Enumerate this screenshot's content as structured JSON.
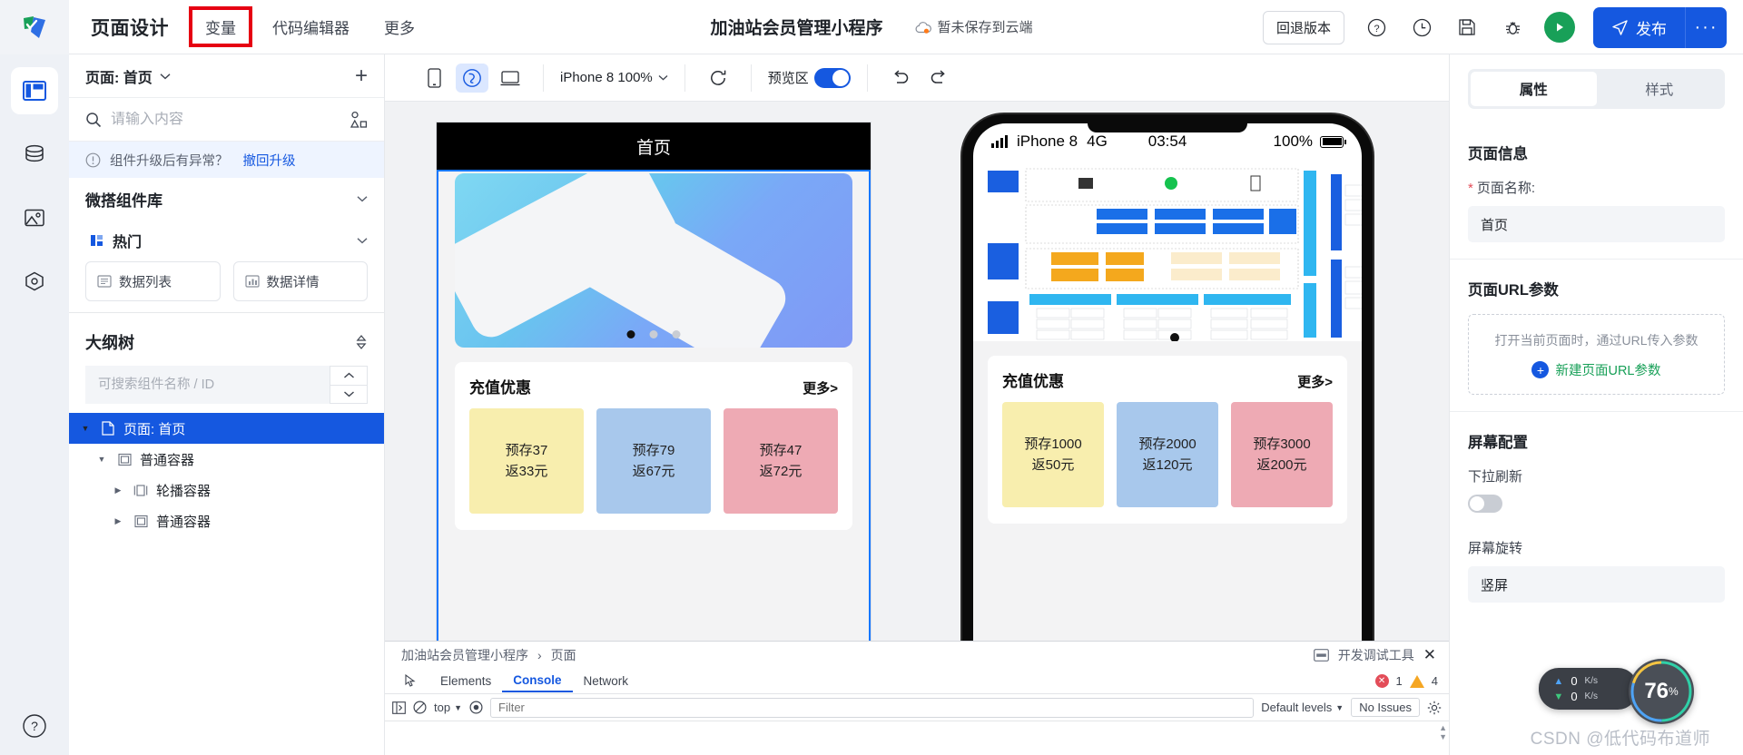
{
  "header": {
    "app_title": "页面设计",
    "nav_items": [
      {
        "label": "变量",
        "highlighted": true
      },
      {
        "label": "代码编辑器",
        "highlighted": false
      },
      {
        "label": "更多",
        "highlighted": false
      }
    ],
    "project_name": "加油站会员管理小程序",
    "cloud_status": "暂未保存到云端",
    "rollback_label": "回退版本",
    "publish_label": "发布",
    "publish_more_label": "···",
    "accent_color": "#1558e0",
    "highlight_color": "#e60012"
  },
  "rail": {
    "items": [
      {
        "name": "layout-icon",
        "active": true
      },
      {
        "name": "database-icon",
        "active": false
      },
      {
        "name": "image-icon",
        "active": false
      },
      {
        "name": "plugin-icon",
        "active": false
      }
    ],
    "help_label": "?"
  },
  "left_panel": {
    "page_selector": "页面: 首页",
    "add_label": "+",
    "search_placeholder": "请输入内容",
    "notice_text": "组件升级后有异常？",
    "notice_link": "撤回升级",
    "library_title": "微搭组件库",
    "hot_title": "热门",
    "components": [
      {
        "label": "数据列表",
        "icon": "list-icon"
      },
      {
        "label": "数据详情",
        "icon": "chart-icon"
      }
    ],
    "outline_title": "大纲树",
    "tree_search_placeholder": "可搜索组件名称 / ID",
    "tree": [
      {
        "label": "页面: 首页",
        "depth": 0,
        "selected": true,
        "expanded": true,
        "icon": "page-icon"
      },
      {
        "label": "普通容器",
        "depth": 1,
        "selected": false,
        "expanded": true,
        "icon": "container-icon"
      },
      {
        "label": "轮播容器",
        "depth": 2,
        "selected": false,
        "expanded": false,
        "icon": "carousel-icon"
      },
      {
        "label": "普通容器",
        "depth": 2,
        "selected": false,
        "expanded": false,
        "icon": "container-icon"
      }
    ]
  },
  "canvas_toolbar": {
    "device_buttons": [
      {
        "name": "phone-view-icon",
        "active": false
      },
      {
        "name": "miniprogram-view-icon",
        "active": true
      },
      {
        "name": "desktop-view-icon",
        "active": false
      }
    ],
    "device_zoom": "iPhone 8 100%",
    "refresh_label": "refresh-icon",
    "preview_label": "预览区",
    "preview_on": true,
    "undo_label": "undo-icon",
    "redo_label": "redo-icon"
  },
  "editor_canvas": {
    "page_title": "首页",
    "banner_dots": 3,
    "banner_active_dot": 0,
    "card": {
      "title": "充值优惠",
      "more": "更多>",
      "tiles": [
        {
          "line1": "预存37",
          "line2": "返33元",
          "color": "#f8eeae"
        },
        {
          "line1": "预存79",
          "line2": "返67元",
          "color": "#a8c8ec"
        },
        {
          "line1": "预存47",
          "line2": "返72元",
          "color": "#eeaab4"
        }
      ]
    }
  },
  "preview_phone": {
    "status": {
      "device": "iPhone 8",
      "network": "4G",
      "time": "03:54",
      "battery": "100%"
    },
    "card": {
      "title": "充值优惠",
      "more": "更多>",
      "tiles": [
        {
          "line1": "预存1000",
          "line2": "返50元",
          "color": "#f8eeae"
        },
        {
          "line1": "预存2000",
          "line2": "返120元",
          "color": "#a8c8ec"
        },
        {
          "line1": "预存3000",
          "line2": "返200元",
          "color": "#eeaab4"
        }
      ]
    }
  },
  "right_panel": {
    "tabs": [
      {
        "label": "属性",
        "active": true
      },
      {
        "label": "样式",
        "active": false
      }
    ],
    "page_info_title": "页面信息",
    "page_name_label": "页面名称:",
    "page_name_value": "首页",
    "url_params_title": "页面URL参数",
    "url_params_hint": "打开当前页面时，通过URL传入参数",
    "url_params_add": "新建页面URL参数",
    "screen_config_title": "屏幕配置",
    "pull_refresh_label": "下拉刷新",
    "pull_refresh_on": false,
    "screen_rotate_label": "屏幕旋转",
    "screen_rotate_value": "竖屏"
  },
  "devtools": {
    "breadcrumb": [
      "加油站会员管理小程序",
      "页面"
    ],
    "panel_label": "开发调试工具",
    "close_label": "✕",
    "tabs": [
      {
        "label": "Elements",
        "active": false
      },
      {
        "label": "Console",
        "active": true
      },
      {
        "label": "Network",
        "active": false
      }
    ],
    "error_count": "1",
    "warning_count": "4",
    "context": "top",
    "filter_placeholder": "Filter",
    "levels": "Default levels",
    "issues": "No Issues"
  },
  "widgets": {
    "net_up": "0",
    "net_down": "0",
    "net_unit": "K/s",
    "cpu_value": "76",
    "cpu_unit": "%",
    "watermark": "CSDN @低代码布道师"
  }
}
